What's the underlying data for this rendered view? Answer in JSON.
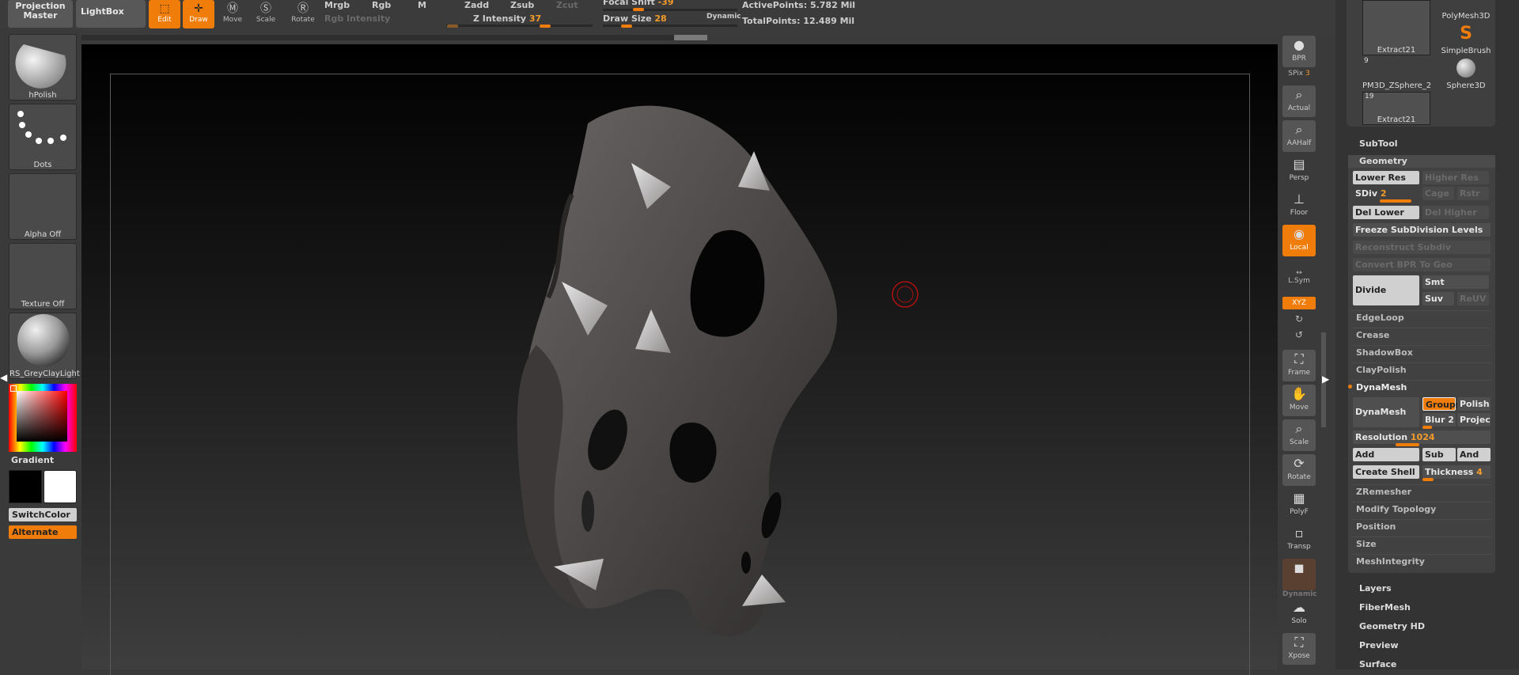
{
  "topbar": {
    "projection_master": "Projection Master",
    "lightbox": "LightBox",
    "tools": [
      {
        "label": "Edit",
        "active": true
      },
      {
        "label": "Draw",
        "active": true
      },
      {
        "label": "Move",
        "active": false
      },
      {
        "label": "Scale",
        "active": false
      },
      {
        "label": "Rotate",
        "active": false
      }
    ],
    "mrgb": "Mrgb",
    "rgb": "Rgb",
    "m": "M",
    "rgb_intensity": "Rgb Intensity",
    "zadd": "Zadd",
    "zsub": "Zsub",
    "zcut": "Zcut",
    "z_intensity_label": "Z Intensity",
    "z_intensity_value": "37",
    "focal_shift_label": "Focal Shift",
    "focal_shift_value": "-39",
    "draw_size_label": "Draw Size",
    "draw_size_value": "28",
    "dynamic": "Dynamic",
    "active_points": "ActivePoints: 5.782 Mil",
    "total_points": "TotalPoints: 12.489 Mil"
  },
  "left_shelf": {
    "brush": "hPolish",
    "stroke": "Dots",
    "alpha": "Alpha  Off",
    "texture": "Texture  Off",
    "material": "RS_GreyClayLight",
    "gradient": "Gradient",
    "switch_color": "SwitchColor",
    "alternate": "Alternate"
  },
  "right_shelf": {
    "bpr": "BPR",
    "spix_label": "SPix",
    "spix_value": "3",
    "actual": "Actual",
    "aahalf": "AAHalf",
    "persp": "Persp",
    "floor": "Floor",
    "local": "Local",
    "lsym": "L.Sym",
    "xyz": "XYZ",
    "frame": "Frame",
    "move": "Move",
    "scale": "Scale",
    "rotate": "Rotate",
    "polyf": "PolyF",
    "transp": "Transp",
    "dynamic": "Dynamic",
    "solo": "Solo",
    "xpose": "Xpose"
  },
  "right_panel": {
    "thumbs": [
      {
        "label": "Extract21",
        "count": ""
      },
      {
        "label": "PolyMesh3D",
        "count": ""
      },
      {
        "label": "SimpleBrush",
        "count": ""
      },
      {
        "label": "PM3D_ZSphere_2",
        "count": "9"
      },
      {
        "label": "Sphere3D",
        "count": ""
      },
      {
        "label": "Extract21",
        "count": "19"
      }
    ],
    "subtool": "SubTool",
    "geometry": "Geometry",
    "lower_res": "Lower Res",
    "higher_res": "Higher Res",
    "sdiv_label": "SDiv",
    "sdiv_value": "2",
    "cage": "Cage",
    "rstr": "Rstr",
    "del_lower": "Del Lower",
    "del_higher": "Del Higher",
    "freeze": "Freeze SubDivision Levels",
    "reconstruct": "Reconstruct Subdiv",
    "convert_bpr": "Convert BPR To Geo",
    "divide": "Divide",
    "smt": "Smt",
    "suv": "Suv",
    "reuv": "ReUV",
    "edgeloop": "EdgeLoop",
    "crease": "Crease",
    "shadowbox": "ShadowBox",
    "claypolish": "ClayPolish",
    "dynamesh_header": "DynaMesh",
    "dynamesh": "DynaMesh",
    "groups": "Groups",
    "polish": "Polish",
    "blur": "Blur",
    "blur_value": "2",
    "projec": "Projec",
    "resolution_label": "Resolution",
    "resolution_value": "1024",
    "add": "Add",
    "sub": "Sub",
    "and": "And",
    "create_shell": "Create Shell",
    "thickness_label": "Thickness",
    "thickness_value": "4",
    "zremesher": "ZRemesher",
    "modify_topology": "Modify Topology",
    "position": "Position",
    "size": "Size",
    "meshintegrity": "MeshIntegrity",
    "layers": "Layers",
    "fibermesh": "FiberMesh",
    "geometry_hd": "Geometry HD",
    "preview": "Preview",
    "surface": "Surface"
  }
}
